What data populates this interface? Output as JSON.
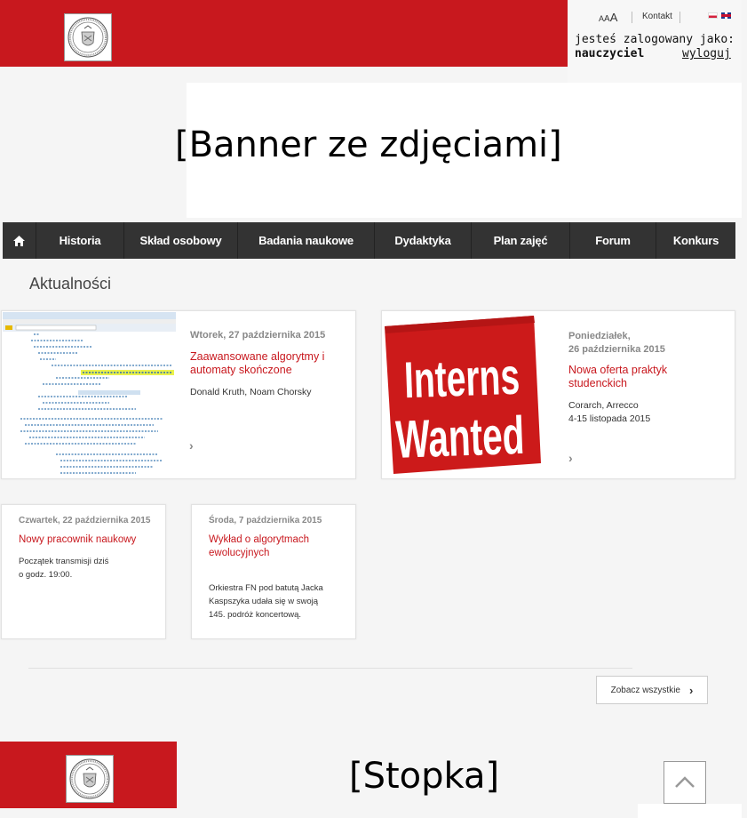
{
  "header": {
    "font_size_label": [
      "A",
      "A",
      "A"
    ],
    "contact_label": "Kontakt",
    "logged_in_as": "jesteś zalogowany jako:",
    "role": "nauczyciel",
    "logout_label": "wyloguj",
    "languages": [
      "pl",
      "en"
    ]
  },
  "banner": {
    "text": "[Banner ze zdjęciami]"
  },
  "nav": {
    "home_icon": "home-icon",
    "items": [
      "Historia",
      "Skład osobowy",
      "Badania naukowe",
      "Dydaktyka",
      "Plan zajęć",
      "Forum",
      "Konkurs"
    ]
  },
  "news": {
    "section_title": "Aktualności",
    "items": [
      {
        "date": "Wtorek, 27 października 2015",
        "title": "Zaawansowane algorytmy i automaty skończone",
        "body": [
          "Donald Kruth, Noam Chorsky"
        ]
      },
      {
        "date": [
          "Poniedziałek,",
          "26 października 2015"
        ],
        "title": "Nowa oferta praktyk studenckich",
        "body": [
          "Corarch, Arrecco",
          "4-15 listopada 2015"
        ],
        "image_text": [
          "Interns",
          "Wanted"
        ]
      },
      {
        "date": "Czwartek, 22 października 2015",
        "title": "Nowy pracownik naukowy",
        "body": [
          "Początek transmisji dziś",
          "o godz. 19:00."
        ]
      },
      {
        "date": "Środa, 7 października 2015",
        "title": "Wykład o algorytmach ewolucyjnych",
        "body": [
          "Orkiestra FN pod batutą Jacka",
          "Kaspszyka udała się w swoją",
          "145. podróż koncertową."
        ]
      }
    ],
    "see_all_label": "Zobacz wszystkie"
  },
  "footer": {
    "text": "[Stopka]",
    "to_top_icon": "chevron-up-icon"
  },
  "colors": {
    "brand_red": "#c8181e",
    "nav_bg": "#333333"
  }
}
